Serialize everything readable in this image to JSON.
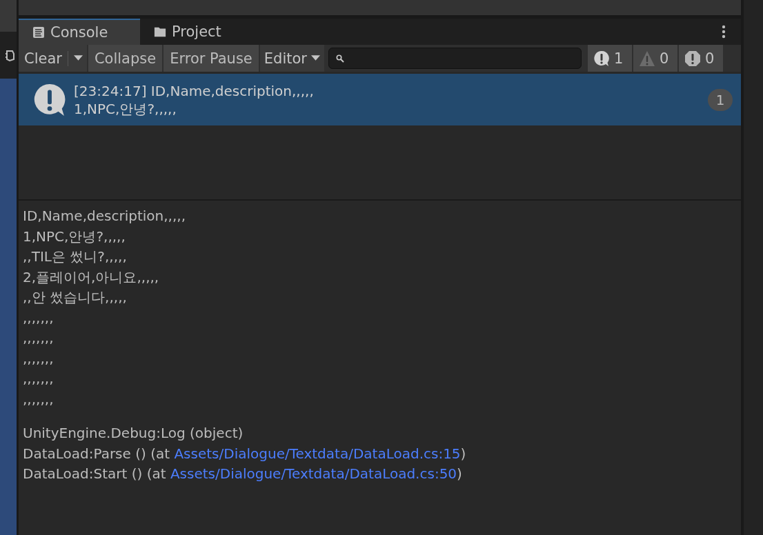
{
  "tabs": [
    {
      "label": "Console",
      "kind": "console",
      "selected": true
    },
    {
      "label": "Project",
      "kind": "project",
      "selected": false
    }
  ],
  "toolbar": {
    "buttons": [
      {
        "label": "Clear",
        "kind": "split"
      },
      {
        "label": "Collapse",
        "kind": "plain"
      },
      {
        "label": "Error Pause",
        "kind": "plain"
      },
      {
        "label": "Editor",
        "kind": "dropdown"
      }
    ],
    "counters": [
      {
        "kind": "info",
        "count": "1"
      },
      {
        "kind": "warning",
        "count": "0"
      },
      {
        "kind": "error",
        "count": "0"
      }
    ]
  },
  "log_entries": [
    {
      "kind": "info",
      "lines": [
        "[23:24:17] ID,Name,description,,,,,",
        "1,NPC,안녕?,,,,,"
      ],
      "count": "1",
      "selected": true
    }
  ],
  "details": {
    "lines": [
      "ID,Name,description,,,,,",
      "1,NPC,안녕?,,,,,",
      ",,TIL은 썼니?,,,,,",
      "2,플레이어,아니요,,,,,",
      ",,안 썼습니다,,,,,",
      ",,,,,,,",
      ",,,,,,,",
      ",,,,,,,",
      ",,,,,,,",
      ",,,,,,,"
    ],
    "stack_trace": [
      {
        "text": "UnityEngine.Debug:Log (object)"
      },
      {
        "text": "DataLoad:Parse () (at ",
        "link": "Assets/Dialogue/Textdata/DataLoad.cs:15",
        "after": ")"
      },
      {
        "text": "DataLoad:Start () (at ",
        "link": "Assets/Dialogue/Textdata/DataLoad.cs:50",
        "after": ")"
      }
    ]
  }
}
